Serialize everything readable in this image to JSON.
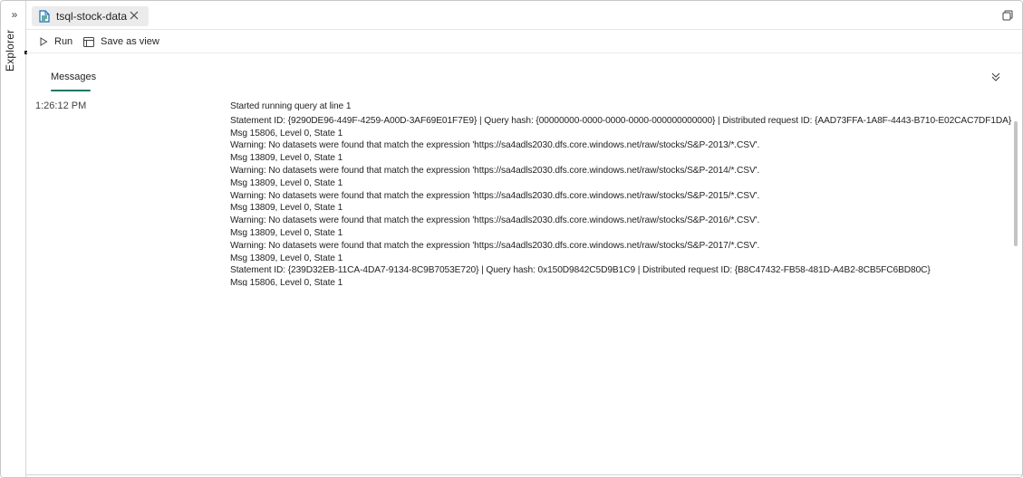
{
  "explorer": {
    "label": "Explorer",
    "expand_icon": "chevron-double-right-icon"
  },
  "tab": {
    "label": "tsql-stock-data",
    "icon": "sql-file-icon",
    "close_icon": "close-icon"
  },
  "window": {
    "restore_icon": "restore-window-icon"
  },
  "toolbar": {
    "run_label": "Run",
    "save_view_label": "Save as view"
  },
  "messages": {
    "tab_label": "Messages",
    "collapse_icon": "chevron-double-down-icon",
    "timestamp": "1:26:12 PM",
    "lines": [
      "Started running query at line 1",
      "Statement ID: {9290DE96-449F-4259-A00D-3AF69E01F7E9} | Query hash: {00000000-0000-0000-0000-000000000000} | Distributed request ID: {AAD73FFA-1A8F-4443-B710-E02CAC7DF1DA}",
      "Msg 15806, Level 0, State 1",
      "Warning: No datasets were found that match the expression 'https://sa4adls2030.dfs.core.windows.net/raw/stocks/S&P-2013/*.CSV'.",
      "Msg 13809, Level 0, State 1",
      "Warning: No datasets were found that match the expression 'https://sa4adls2030.dfs.core.windows.net/raw/stocks/S&P-2014/*.CSV'.",
      "Msg 13809, Level 0, State 1",
      "Warning: No datasets were found that match the expression 'https://sa4adls2030.dfs.core.windows.net/raw/stocks/S&P-2015/*.CSV'.",
      "Msg 13809, Level 0, State 1",
      "Warning: No datasets were found that match the expression 'https://sa4adls2030.dfs.core.windows.net/raw/stocks/S&P-2016/*.CSV'.",
      "Msg 13809, Level 0, State 1",
      "Warning: No datasets were found that match the expression 'https://sa4adls2030.dfs.core.windows.net/raw/stocks/S&P-2017/*.CSV'.",
      "Msg 13809, Level 0, State 1",
      "Statement ID: {239D32EB-11CA-4DA7-9134-8C9B7053E720} | Query hash: 0x150D9842C5D9B1C9 | Distributed request ID: {B8C47432-FB58-481D-A4B2-8CB5FC6BD80C}",
      "Msg 15806, Level 0, State 1"
    ]
  },
  "colors": {
    "accent": "#117865",
    "sql_icon": "#0f6cbd"
  }
}
